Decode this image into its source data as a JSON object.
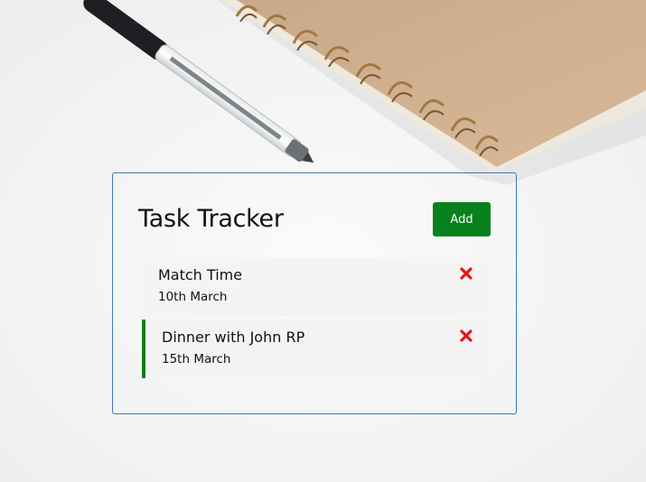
{
  "header": {
    "title": "Task Tracker",
    "add_label": "Add"
  },
  "tasks": [
    {
      "name": "Match Time",
      "date": "10th March",
      "reminder": false
    },
    {
      "name": "Dinner with John RP",
      "date": "15th March",
      "reminder": true
    }
  ],
  "icons": {
    "delete": "close-icon"
  },
  "colors": {
    "accent": "#07811b",
    "delete": "#e8141b",
    "card_border": "#3d79b5",
    "task_bg": "#f4f4f4"
  }
}
